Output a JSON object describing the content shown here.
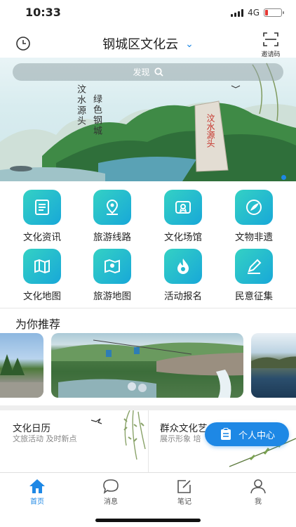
{
  "status": {
    "time": "10:33",
    "network": "4G"
  },
  "header": {
    "title": "钢城区文化云",
    "invite_label": "邀请码"
  },
  "banner": {
    "search_placeholder": "发现",
    "poem_lines": [
      "汶",
      "水",
      "源",
      "头"
    ],
    "poem_right": [
      "绿",
      "色",
      "钢",
      "城"
    ],
    "stone_text": "汶水源头"
  },
  "grid": [
    {
      "label": "文化资讯",
      "icon": "news-icon"
    },
    {
      "label": "旅游线路",
      "icon": "route-pin-icon"
    },
    {
      "label": "文化场馆",
      "icon": "venue-icon"
    },
    {
      "label": "文物非遗",
      "icon": "heritage-icon"
    },
    {
      "label": "文化地图",
      "icon": "map-icon"
    },
    {
      "label": "旅游地图",
      "icon": "tour-map-icon"
    },
    {
      "label": "活动报名",
      "icon": "flame-icon"
    },
    {
      "label": "民意征集",
      "icon": "pen-icon"
    }
  ],
  "recommend": {
    "title": "为你推荐"
  },
  "bottom_cards": [
    {
      "title": "文化日历",
      "subtitle": "文旅活动 及时新点"
    },
    {
      "title": "群众文化艺",
      "subtitle": "展示形象 培"
    }
  ],
  "floating": {
    "label": "个人中心"
  },
  "tabs": [
    {
      "label": "首页",
      "active": true
    },
    {
      "label": "消息",
      "active": false
    },
    {
      "label": "笔记",
      "active": false
    },
    {
      "label": "我",
      "active": false
    }
  ],
  "colors": {
    "accent": "#1e88e5",
    "icon_gradient_start": "#34d1c4",
    "icon_gradient_end": "#18a8d8"
  }
}
